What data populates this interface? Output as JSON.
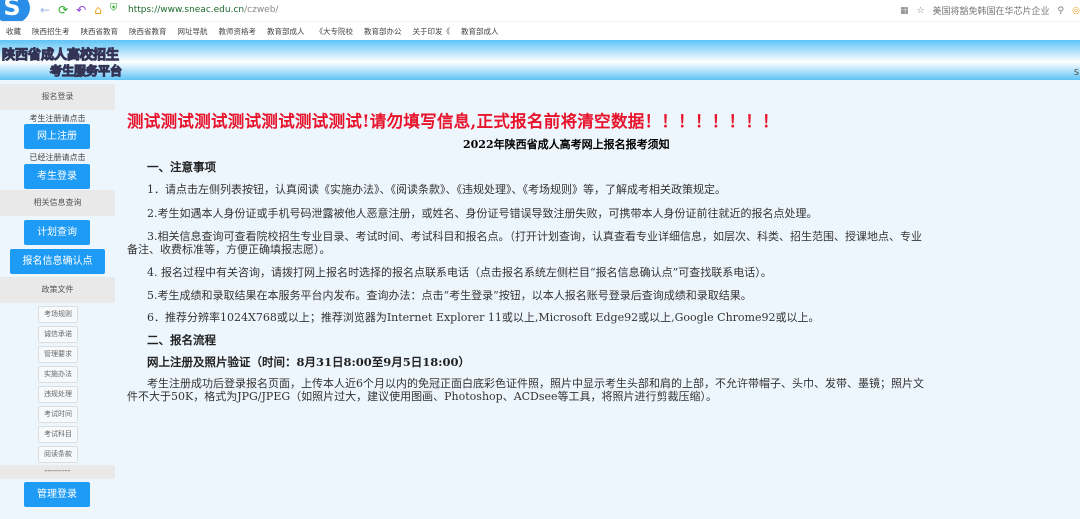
{
  "browser": {
    "url_host": "https://www.sneac.edu.cn",
    "url_path": "/czweb/",
    "news": "美国将豁免韩国在华芯片企业",
    "bookmarks": [
      "收藏",
      "陕西招生考",
      "陕西省教育",
      "陕西省教育",
      "网址导航",
      "教师资格考",
      "教育部成人",
      "《大专院校",
      "教育部办公",
      "关于印发《",
      "教育部成人"
    ]
  },
  "banner": {
    "line1": "陕西省成人高校招生",
    "line2": "考生服务平台",
    "corner": "S"
  },
  "sidebar": {
    "section1": "报名登录",
    "register_hint": "考生注册请点击",
    "register": "网上注册",
    "login_hint": "已经注册请点击",
    "login": "考生登录",
    "section2": "相关信息查询",
    "plan_query": "计划查询",
    "site_confirm": "报名信息确认点",
    "section3": "政策文件",
    "docs": [
      "考场规则",
      "诚信承诺",
      "管理要求",
      "实施办法",
      "违规处理",
      "考试时间",
      "考试科目",
      "阅读条款"
    ],
    "divider": "---------",
    "admin_login": "管理登录"
  },
  "main": {
    "warning": "测试测试测试测试测试测试测试!请勿填写信息,正式报名前将清空数据！！！！！！！！",
    "title": "2022年陕西省成人高考网上报名报考须知",
    "h1": "一、注意事项",
    "items": [
      "1．请点击左侧列表按钮，认真阅读《实施办法》、《阅读条款》、《违规处理》、《考场规则》等，了解成考相关政策规定。",
      "2.考生如遇本人身份证或手机号码泄露被他人恶意注册，或姓名、身份证号错误导致注册失败，可携带本人身份证前往就近的报名点处理。",
      "3.相关信息查询可查看院校招生专业目录、考试时间、考试科目和报名点。（打开计划查询，认真查看专业详细信息，如层次、科类、招生范围、授课地点、专业备注、收费标准等，方便正确填报志愿）。",
      "4. 报名过程中有关咨询，请拨打网上报名时选择的报名点联系电话（点击报名系统左侧栏目“报名信息确认点”可查找联系电话）。",
      "5.考生成绩和录取结果在本服务平台内发布。查询办法：点击“考生登录”按钮，以本人报名账号登录后查询成绩和录取结果。",
      "6．推荐分辨率1024X768或以上；推荐浏览器为Internet Explorer 11或以上,Microsoft Edge92或以上,Google Chrome92或以上。"
    ],
    "h2": "二、报名流程",
    "h3": "网上注册及照片验证（时间：8月31日8:00至9月5日18:00）",
    "photo": "考生注册成功后登录报名页面，上传本人近6个月以内的免冠正面白底彩色证件照，照片中显示考生头部和肩的上部，不允许带帽子、头巾、发带、墨镜；照片文件不大于50K，格式为JPG/JPEG（如照片过大，建议使用图画、Photoshop、ACDsee等工具，将照片进行剪裁压缩）。"
  }
}
